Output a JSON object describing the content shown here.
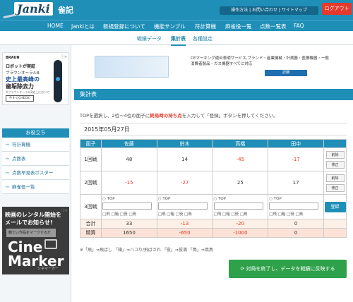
{
  "header": {
    "logo": "Janki",
    "logo_sub": "雀記",
    "util_links": "操作方法 | お問い合わせ | サイトマップ",
    "logout": "ログアウト"
  },
  "nav": [
    "HOME",
    "Jankiとは",
    "新規登録について",
    "機能サンプル",
    "符計算機",
    "麻雀役一覧",
    "点数一覧表",
    "FAQ"
  ],
  "subnav": [
    "戦績データ",
    "集計表",
    "各種設定"
  ],
  "ad_left": {
    "brand": "BRAUN",
    "l1": "ロボットが実証",
    "l2": "ブラウンオーラルB",
    "l3": "史上最高峰の",
    "l4": "歯垢除去力",
    "l5": "※ブラウンオーラルB史上において",
    "l6": "今すぐCHECK!"
  },
  "help": {
    "title": "お役立ち",
    "items": [
      "符計算機",
      "点数表",
      "点数早見表ポスター",
      "麻雀役一覧"
    ]
  },
  "ad_movie": {
    "t1": "映画のレンタル開始を\nメールでお知らせ!",
    "t2": "観たい作品をマークするだけ。",
    "logo": "Cine\nMarker",
    "sub": "シネマーカー"
  },
  "banner": {
    "text": "CEマーキング適合表明サービス,ブランド・産業機械・計測器・医療機器・一般消費者製品・ガス機器すべてに対応",
    "button": "詳細"
  },
  "section_title": "集計表",
  "description_pre": "TOPを選択し、2位〜4位の面子に",
  "description_em": "終局時の持ち点",
  "description_post": "を入力して「登録」ボタンを押してください。",
  "date": "2015年05月27日",
  "table": {
    "headers": [
      "面子",
      "佐藤",
      "鈴木",
      "高橋",
      "田中",
      ""
    ],
    "rows": [
      {
        "label": "1回戦",
        "values": [
          "48",
          "14",
          "-45",
          "-17"
        ]
      },
      {
        "label": "2回戦",
        "values": [
          "-15",
          "-27",
          "25",
          "17"
        ]
      }
    ],
    "edit_buttons": [
      "削除",
      "修正"
    ],
    "round3_label": "3回戦",
    "top_label": "TOP",
    "yaku_options": "□飛 □箱 □役 □鳥",
    "register": "登録",
    "total_label": "合計",
    "total": [
      "33",
      "-13",
      "-20",
      "0"
    ],
    "score_label": "精算",
    "score": [
      "1650",
      "-650",
      "-1000",
      "0"
    ]
  },
  "note": "※「飛」⇒飛ばし 「箱」⇒ハコり/飛ばされ 「役」⇒役満 「鳥」⇒焼鳥",
  "finish_button": "対局を終了し、データを戦績に反映する"
}
